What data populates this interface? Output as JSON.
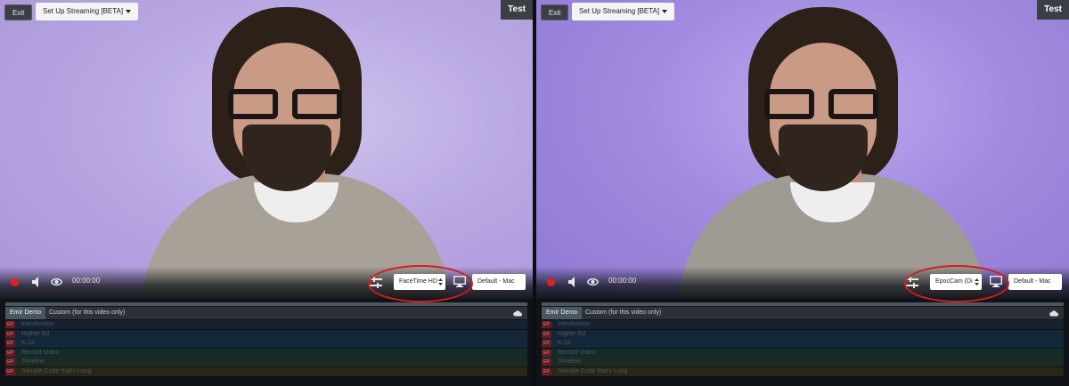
{
  "panels": [
    {
      "exit_label": "Exit",
      "stream_label": "Set Up Streaming [BETA]",
      "test_label": "Test",
      "timecode": "00:00:00",
      "camera_select": "FaceTime HD",
      "output_select": "Default - Mac",
      "tabs": [
        "Emir Demo",
        "Custom (for this video only)"
      ],
      "chapters": [
        {
          "badge": "EP",
          "title": "Introduction"
        },
        {
          "badge": "EP",
          "title": "Higher Ed"
        },
        {
          "badge": "EP",
          "title": "K-12"
        },
        {
          "badge": "EP",
          "title": "Record Video"
        },
        {
          "badge": "EP",
          "title": "Timeline"
        },
        {
          "badge": "EP",
          "title": "Sample Code that's Long"
        }
      ]
    },
    {
      "exit_label": "Exit",
      "stream_label": "Set Up Streaming [BETA]",
      "test_label": "Test",
      "timecode": "00:00:00",
      "camera_select": "EpocCam (Di",
      "output_select": "Default - Mac",
      "tabs": [
        "Emir Demo",
        "Custom (for this video only)"
      ],
      "chapters": [
        {
          "badge": "EP",
          "title": "Introduction"
        },
        {
          "badge": "EP",
          "title": "Higher Ed"
        },
        {
          "badge": "EP",
          "title": "K-12"
        },
        {
          "badge": "EP",
          "title": "Record Video"
        },
        {
          "badge": "EP",
          "title": "Timeline"
        },
        {
          "badge": "EP",
          "title": "Sample Code that's Long"
        }
      ]
    }
  ],
  "colors": {
    "record": "#e22020",
    "highlight_ring": "#d21d1d",
    "backdrop_left": "#b9a8e3",
    "backdrop_right": "#a18be0"
  },
  "icons": [
    "record-icon",
    "speaker-icon",
    "eye-icon",
    "levels-icon",
    "monitor-icon",
    "cloud-icon",
    "chevron-down-icon"
  ]
}
